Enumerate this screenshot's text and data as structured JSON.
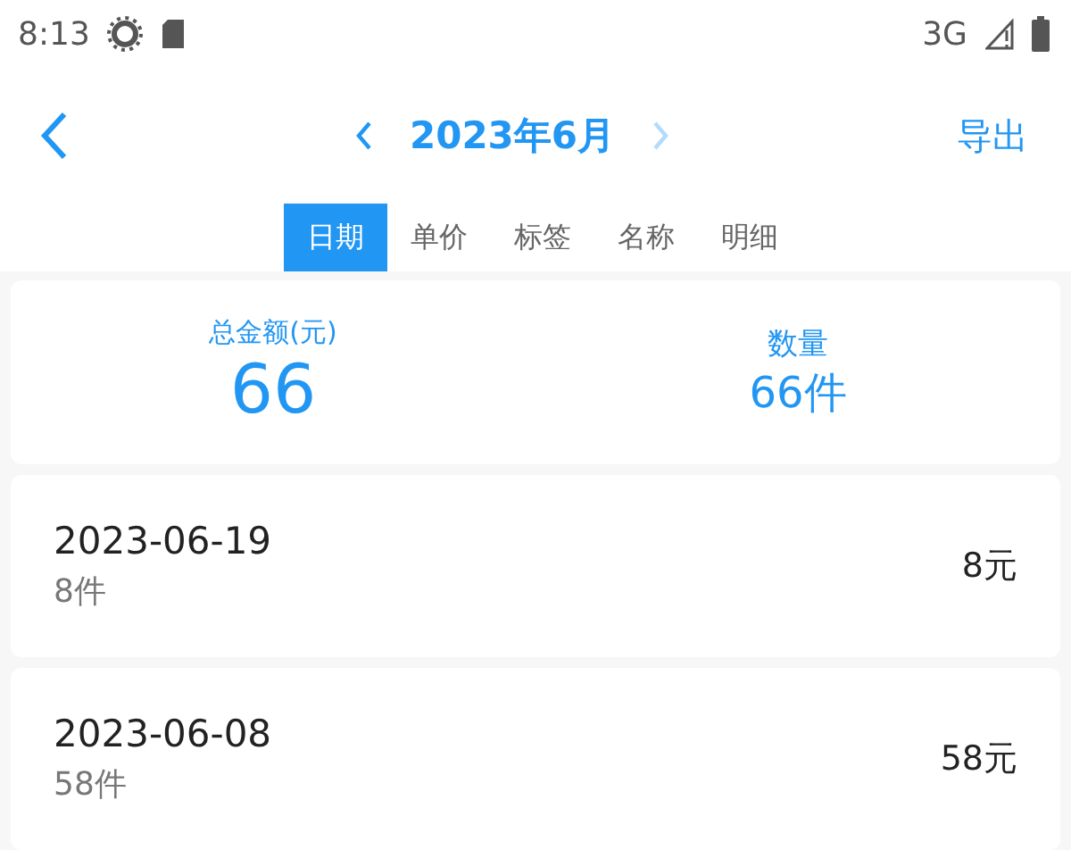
{
  "status_bar": {
    "time": "8:13",
    "network": "3G"
  },
  "header": {
    "month": "2023年6月",
    "prev_disabled": false,
    "next_disabled": true,
    "action": "导出"
  },
  "tabs": [
    {
      "label": "日期",
      "selected": true
    },
    {
      "label": "单价",
      "selected": false
    },
    {
      "label": "标签",
      "selected": false
    },
    {
      "label": "名称",
      "selected": false
    },
    {
      "label": "明细",
      "selected": false
    }
  ],
  "summary": {
    "total_label": "总金额(元)",
    "total_value": "66",
    "count_label": "数量",
    "count_value": "66件"
  },
  "rows": [
    {
      "date": "2023-06-19",
      "count": "8件",
      "amount": "8元"
    },
    {
      "date": "2023-06-08",
      "count": "58件",
      "amount": "58元"
    }
  ]
}
